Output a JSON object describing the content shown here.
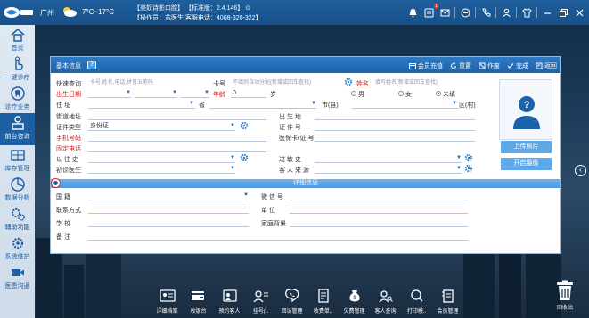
{
  "topbar": {
    "city": "广州",
    "temperature": "7°C~17°C",
    "line1": "【美奴诗影口腔】   【标准版：2.4.146】   ⊙",
    "line2": "【操作员：苏医生  客服电话：4008-320-322】",
    "message_badge": "1",
    "icons": [
      "bell-icon",
      "message-icon",
      "mail-icon",
      "minus-circle-icon",
      "phone-icon",
      "user-icon",
      "shirt-icon",
      "minimize-icon",
      "restore-icon",
      "close-icon"
    ]
  },
  "sidebar": {
    "items": [
      {
        "label": "首页",
        "icon": "home-icon"
      },
      {
        "label": "一键诊疗",
        "icon": "hand-click-icon"
      },
      {
        "label": "诊疗业务",
        "icon": "tooth-icon"
      },
      {
        "label": "前台咨询",
        "icon": "reception-icon"
      },
      {
        "label": "库存管理",
        "icon": "inventory-icon"
      },
      {
        "label": "数据分析",
        "icon": "analysis-icon"
      },
      {
        "label": "辅助功能",
        "icon": "gears-icon"
      },
      {
        "label": "系统维护",
        "icon": "maintenance-icon"
      },
      {
        "label": "医患沟通",
        "icon": "video-icon"
      }
    ]
  },
  "panel": {
    "title": "基本信息",
    "help": "?",
    "actions": [
      {
        "label": "会员充值",
        "icon": "card-icon"
      },
      {
        "label": "重置",
        "icon": "refresh-icon"
      },
      {
        "label": "作废",
        "icon": "void-icon"
      },
      {
        "label": "完成",
        "icon": "check-icon"
      },
      {
        "label": "返回",
        "icon": "return-icon"
      }
    ],
    "form": {
      "quick_search_label": "快速查询",
      "quick_search_placeholder": "卡号,姓名,电话,拼音五笔码",
      "card_label": "卡号",
      "card_placeholder": "不填则自动分配(新增或回车查找)",
      "name_label": "姓名",
      "name_placeholder": "填写姓名(新增或回车查找)",
      "birth_label": "出生日期",
      "age_label": "年龄",
      "age_value": "0",
      "age_unit": "岁",
      "gender_options": [
        "男",
        "女",
        "未填"
      ],
      "gender_selected": "未填",
      "address_label": "住    址",
      "province_label": "省",
      "city_label": "市(县)",
      "district_label": "区(村)",
      "street_label": "街道地址",
      "birthplace_label": "出  生  地",
      "id_type_label": "证件类型",
      "id_type_value": "身份证",
      "id_no_label": "证  件  号",
      "phone_label": "手机号码",
      "medical_card_label": "医保卡(证)号",
      "fixed_phone_label": "固定电话",
      "history_label": "以  往  史",
      "allergy_label": "过  敏  史",
      "doctor_label": "初诊医生",
      "source_label": "客  人  来  源"
    },
    "upload_photo": "上传照片",
    "open_camera": "开启摄像",
    "detail_title": "详细信息",
    "detail": {
      "nationality_label": "国    籍",
      "wechat_label": "微 信 号",
      "contact_label": "联系方式",
      "employer_label": "单    位",
      "school_label": "学    校",
      "family_label": "家庭背景",
      "notes_label": "备    注"
    }
  },
  "bottombar": {
    "items": [
      {
        "label": "详细档案",
        "icon": "profile-icon"
      },
      {
        "label": "收银台",
        "icon": "cashier-icon"
      },
      {
        "label": "预约客人",
        "icon": "appointment-icon"
      },
      {
        "label": "挂号(..",
        "icon": "register-icon"
      },
      {
        "label": "回访管理",
        "icon": "callback-icon"
      },
      {
        "label": "收费单..",
        "icon": "bill-icon"
      },
      {
        "label": "欠费管理",
        "icon": "debt-icon"
      },
      {
        "label": "客人查询",
        "icon": "customer-search-icon"
      },
      {
        "label": "打印模..",
        "icon": "print-icon"
      },
      {
        "label": "会员管理",
        "icon": "member-icon"
      }
    ],
    "trash_label": "回收站"
  },
  "colors": {
    "accent": "#1c62aa",
    "header": "#2e7bc4",
    "required": "#d32020",
    "button": "#5fa8e8"
  }
}
